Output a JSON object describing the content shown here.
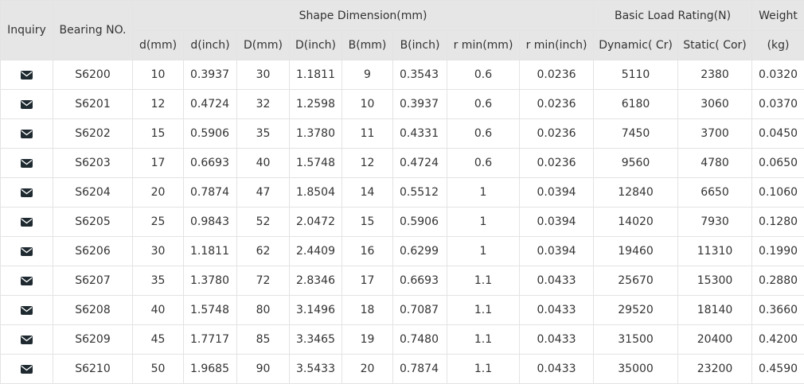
{
  "headers": {
    "inquiry": "Inquiry",
    "bearing_no": "Bearing NO.",
    "shape_dimension": "Shape Dimension(mm)",
    "basic_load_rating": "Basic Load Rating(N)",
    "weight": "Weight",
    "weight_unit": "(kg)",
    "sub": [
      "d(mm)",
      "d(inch)",
      "D(mm)",
      "D(inch)",
      "B(mm)",
      "B(inch)",
      "r min(mm)",
      "r min(inch)",
      "Dynamic( Cr)",
      "Static( Cor)"
    ]
  },
  "rows": [
    [
      "S6200",
      "10",
      "0.3937",
      "30",
      "1.1811",
      "9",
      "0.3543",
      "0.6",
      "0.0236",
      "5110",
      "2380",
      "0.0320"
    ],
    [
      "S6201",
      "12",
      "0.4724",
      "32",
      "1.2598",
      "10",
      "0.3937",
      "0.6",
      "0.0236",
      "6180",
      "3060",
      "0.0370"
    ],
    [
      "S6202",
      "15",
      "0.5906",
      "35",
      "1.3780",
      "11",
      "0.4331",
      "0.6",
      "0.0236",
      "7450",
      "3700",
      "0.0450"
    ],
    [
      "S6203",
      "17",
      "0.6693",
      "40",
      "1.5748",
      "12",
      "0.4724",
      "0.6",
      "0.0236",
      "9560",
      "4780",
      "0.0650"
    ],
    [
      "S6204",
      "20",
      "0.7874",
      "47",
      "1.8504",
      "14",
      "0.5512",
      "1",
      "0.0394",
      "12840",
      "6650",
      "0.1060"
    ],
    [
      "S6205",
      "25",
      "0.9843",
      "52",
      "2.0472",
      "15",
      "0.5906",
      "1",
      "0.0394",
      "14020",
      "7930",
      "0.1280"
    ],
    [
      "S6206",
      "30",
      "1.1811",
      "62",
      "2.4409",
      "16",
      "0.6299",
      "1",
      "0.0394",
      "19460",
      "11310",
      "0.1990"
    ],
    [
      "S6207",
      "35",
      "1.3780",
      "72",
      "2.8346",
      "17",
      "0.6693",
      "1.1",
      "0.0433",
      "25670",
      "15300",
      "0.2880"
    ],
    [
      "S6208",
      "40",
      "1.5748",
      "80",
      "3.1496",
      "18",
      "0.7087",
      "1.1",
      "0.0433",
      "29520",
      "18140",
      "0.3660"
    ],
    [
      "S6209",
      "45",
      "1.7717",
      "85",
      "3.3465",
      "19",
      "0.7480",
      "1.1",
      "0.0433",
      "31500",
      "20400",
      "0.4200"
    ],
    [
      "S6210",
      "50",
      "1.9685",
      "90",
      "3.5433",
      "20",
      "0.7874",
      "1.1",
      "0.0433",
      "35000",
      "23200",
      "0.4590"
    ]
  ],
  "icons": {
    "inquiry": "envelope-icon"
  }
}
